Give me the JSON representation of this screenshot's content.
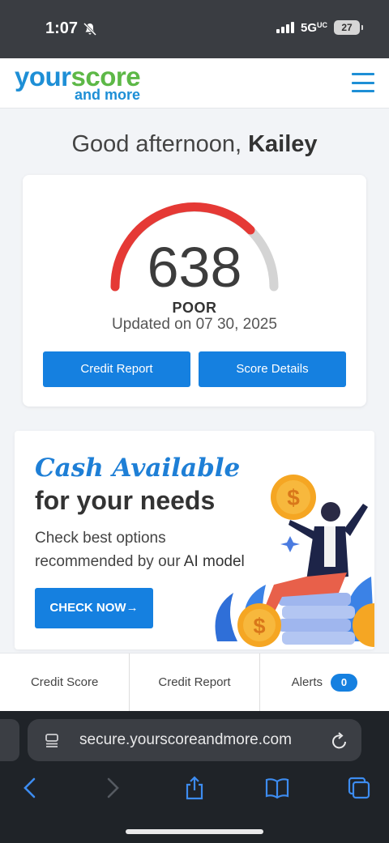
{
  "status_bar": {
    "time": "1:07",
    "network": "5G",
    "network_suffix": "UC",
    "battery": "27"
  },
  "header": {
    "logo_part1": "your",
    "logo_part2": "score",
    "logo_part3": "and more"
  },
  "greeting": {
    "prefix": "Good afternoon, ",
    "name": "Kailey"
  },
  "score_card": {
    "score": "638",
    "rating": "POOR",
    "updated": "Updated on 07 30, 2025",
    "credit_report_button": "Credit Report",
    "score_details_button": "Score Details",
    "gauge_colors": {
      "filled": "#e53935",
      "track": "#d4d4d4"
    }
  },
  "promo": {
    "title": "Cash Available",
    "subtitle": "for your needs",
    "desc_line1": "Check best options",
    "desc_line2_prefix": "recommended by our ",
    "desc_line2_highlight": "AI model",
    "cta": "CHECK NOW→"
  },
  "tabs": [
    {
      "label": "Credit Score"
    },
    {
      "label": "Credit Report"
    },
    {
      "label": "Alerts",
      "badge": "0"
    }
  ],
  "browser": {
    "url": "secure.yourscoreandmore.com"
  },
  "colors": {
    "accent": "#1580e0",
    "brand_blue": "#1e8fd6",
    "brand_green": "#5db847"
  }
}
